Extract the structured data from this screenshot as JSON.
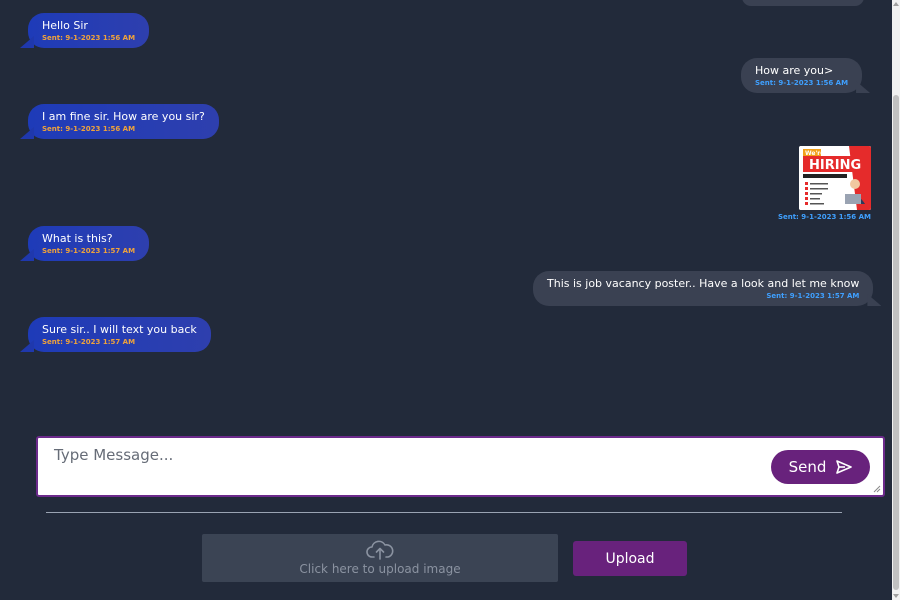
{
  "messages": [
    {
      "side": "left",
      "text": "Hello Sir",
      "timestamp": "Sent: 9-1-2023 1:56 AM"
    },
    {
      "side": "right",
      "text": "How are you>",
      "timestamp": "Sent: 9-1-2023 1:56 AM"
    },
    {
      "side": "left",
      "text": "I am fine sir. How are you sir?",
      "timestamp": "Sent: 9-1-2023 1:56 AM"
    },
    {
      "side": "right",
      "type": "image",
      "image_text": "We're HIRING",
      "timestamp": "Sent: 9-1-2023 1:56 AM"
    },
    {
      "side": "left",
      "text": "What is this?",
      "timestamp": "Sent: 9-1-2023 1:57 AM"
    },
    {
      "side": "right",
      "text": "This is job vacancy poster.. Have a look and let me know",
      "timestamp": "Sent: 9-1-2023 1:57 AM"
    },
    {
      "side": "left",
      "text": "Sure sir.. I will text you back",
      "timestamp": "Sent: 9-1-2023 1:57 AM"
    }
  ],
  "composer": {
    "placeholder": "Type Message...",
    "send_label": "Send",
    "send_icon": "paper-plane-icon"
  },
  "upload": {
    "icon": "cloud-upload-icon",
    "zone_label": "Click here to upload image",
    "button_label": "Upload"
  },
  "colors": {
    "page_bg": "#222a3a",
    "left_bubble": "#1e3bb8",
    "right_bubble": "#3a4152",
    "left_timestamp": "#f0a33a",
    "right_timestamp": "#3fa0ff",
    "accent": "#68227c"
  }
}
